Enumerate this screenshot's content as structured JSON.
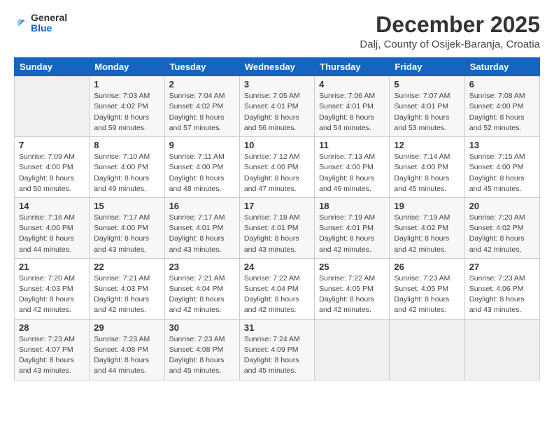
{
  "logo": {
    "general": "General",
    "blue": "Blue"
  },
  "title": "December 2025",
  "subtitle": "Dalj, County of Osijek-Baranja, Croatia",
  "days_of_week": [
    "Sunday",
    "Monday",
    "Tuesday",
    "Wednesday",
    "Thursday",
    "Friday",
    "Saturday"
  ],
  "weeks": [
    [
      {
        "day": "",
        "info": ""
      },
      {
        "day": "1",
        "info": "Sunrise: 7:03 AM\nSunset: 4:02 PM\nDaylight: 8 hours\nand 59 minutes."
      },
      {
        "day": "2",
        "info": "Sunrise: 7:04 AM\nSunset: 4:02 PM\nDaylight: 8 hours\nand 57 minutes."
      },
      {
        "day": "3",
        "info": "Sunrise: 7:05 AM\nSunset: 4:01 PM\nDaylight: 8 hours\nand 56 minutes."
      },
      {
        "day": "4",
        "info": "Sunrise: 7:06 AM\nSunset: 4:01 PM\nDaylight: 8 hours\nand 54 minutes."
      },
      {
        "day": "5",
        "info": "Sunrise: 7:07 AM\nSunset: 4:01 PM\nDaylight: 8 hours\nand 53 minutes."
      },
      {
        "day": "6",
        "info": "Sunrise: 7:08 AM\nSunset: 4:00 PM\nDaylight: 8 hours\nand 52 minutes."
      }
    ],
    [
      {
        "day": "7",
        "info": "Sunrise: 7:09 AM\nSunset: 4:00 PM\nDaylight: 8 hours\nand 50 minutes."
      },
      {
        "day": "8",
        "info": "Sunrise: 7:10 AM\nSunset: 4:00 PM\nDaylight: 8 hours\nand 49 minutes."
      },
      {
        "day": "9",
        "info": "Sunrise: 7:11 AM\nSunset: 4:00 PM\nDaylight: 8 hours\nand 48 minutes."
      },
      {
        "day": "10",
        "info": "Sunrise: 7:12 AM\nSunset: 4:00 PM\nDaylight: 8 hours\nand 47 minutes."
      },
      {
        "day": "11",
        "info": "Sunrise: 7:13 AM\nSunset: 4:00 PM\nDaylight: 8 hours\nand 46 minutes."
      },
      {
        "day": "12",
        "info": "Sunrise: 7:14 AM\nSunset: 4:00 PM\nDaylight: 8 hours\nand 45 minutes."
      },
      {
        "day": "13",
        "info": "Sunrise: 7:15 AM\nSunset: 4:00 PM\nDaylight: 8 hours\nand 45 minutes."
      }
    ],
    [
      {
        "day": "14",
        "info": "Sunrise: 7:16 AM\nSunset: 4:00 PM\nDaylight: 8 hours\nand 44 minutes."
      },
      {
        "day": "15",
        "info": "Sunrise: 7:17 AM\nSunset: 4:00 PM\nDaylight: 8 hours\nand 43 minutes."
      },
      {
        "day": "16",
        "info": "Sunrise: 7:17 AM\nSunset: 4:01 PM\nDaylight: 8 hours\nand 43 minutes."
      },
      {
        "day": "17",
        "info": "Sunrise: 7:18 AM\nSunset: 4:01 PM\nDaylight: 8 hours\nand 43 minutes."
      },
      {
        "day": "18",
        "info": "Sunrise: 7:19 AM\nSunset: 4:01 PM\nDaylight: 8 hours\nand 42 minutes."
      },
      {
        "day": "19",
        "info": "Sunrise: 7:19 AM\nSunset: 4:02 PM\nDaylight: 8 hours\nand 42 minutes."
      },
      {
        "day": "20",
        "info": "Sunrise: 7:20 AM\nSunset: 4:02 PM\nDaylight: 8 hours\nand 42 minutes."
      }
    ],
    [
      {
        "day": "21",
        "info": "Sunrise: 7:20 AM\nSunset: 4:03 PM\nDaylight: 8 hours\nand 42 minutes."
      },
      {
        "day": "22",
        "info": "Sunrise: 7:21 AM\nSunset: 4:03 PM\nDaylight: 8 hours\nand 42 minutes."
      },
      {
        "day": "23",
        "info": "Sunrise: 7:21 AM\nSunset: 4:04 PM\nDaylight: 8 hours\nand 42 minutes."
      },
      {
        "day": "24",
        "info": "Sunrise: 7:22 AM\nSunset: 4:04 PM\nDaylight: 8 hours\nand 42 minutes."
      },
      {
        "day": "25",
        "info": "Sunrise: 7:22 AM\nSunset: 4:05 PM\nDaylight: 8 hours\nand 42 minutes."
      },
      {
        "day": "26",
        "info": "Sunrise: 7:23 AM\nSunset: 4:05 PM\nDaylight: 8 hours\nand 42 minutes."
      },
      {
        "day": "27",
        "info": "Sunrise: 7:23 AM\nSunset: 4:06 PM\nDaylight: 8 hours\nand 43 minutes."
      }
    ],
    [
      {
        "day": "28",
        "info": "Sunrise: 7:23 AM\nSunset: 4:07 PM\nDaylight: 8 hours\nand 43 minutes."
      },
      {
        "day": "29",
        "info": "Sunrise: 7:23 AM\nSunset: 4:08 PM\nDaylight: 8 hours\nand 44 minutes."
      },
      {
        "day": "30",
        "info": "Sunrise: 7:23 AM\nSunset: 4:08 PM\nDaylight: 8 hours\nand 45 minutes."
      },
      {
        "day": "31",
        "info": "Sunrise: 7:24 AM\nSunset: 4:09 PM\nDaylight: 8 hours\nand 45 minutes."
      },
      {
        "day": "",
        "info": ""
      },
      {
        "day": "",
        "info": ""
      },
      {
        "day": "",
        "info": ""
      }
    ]
  ]
}
